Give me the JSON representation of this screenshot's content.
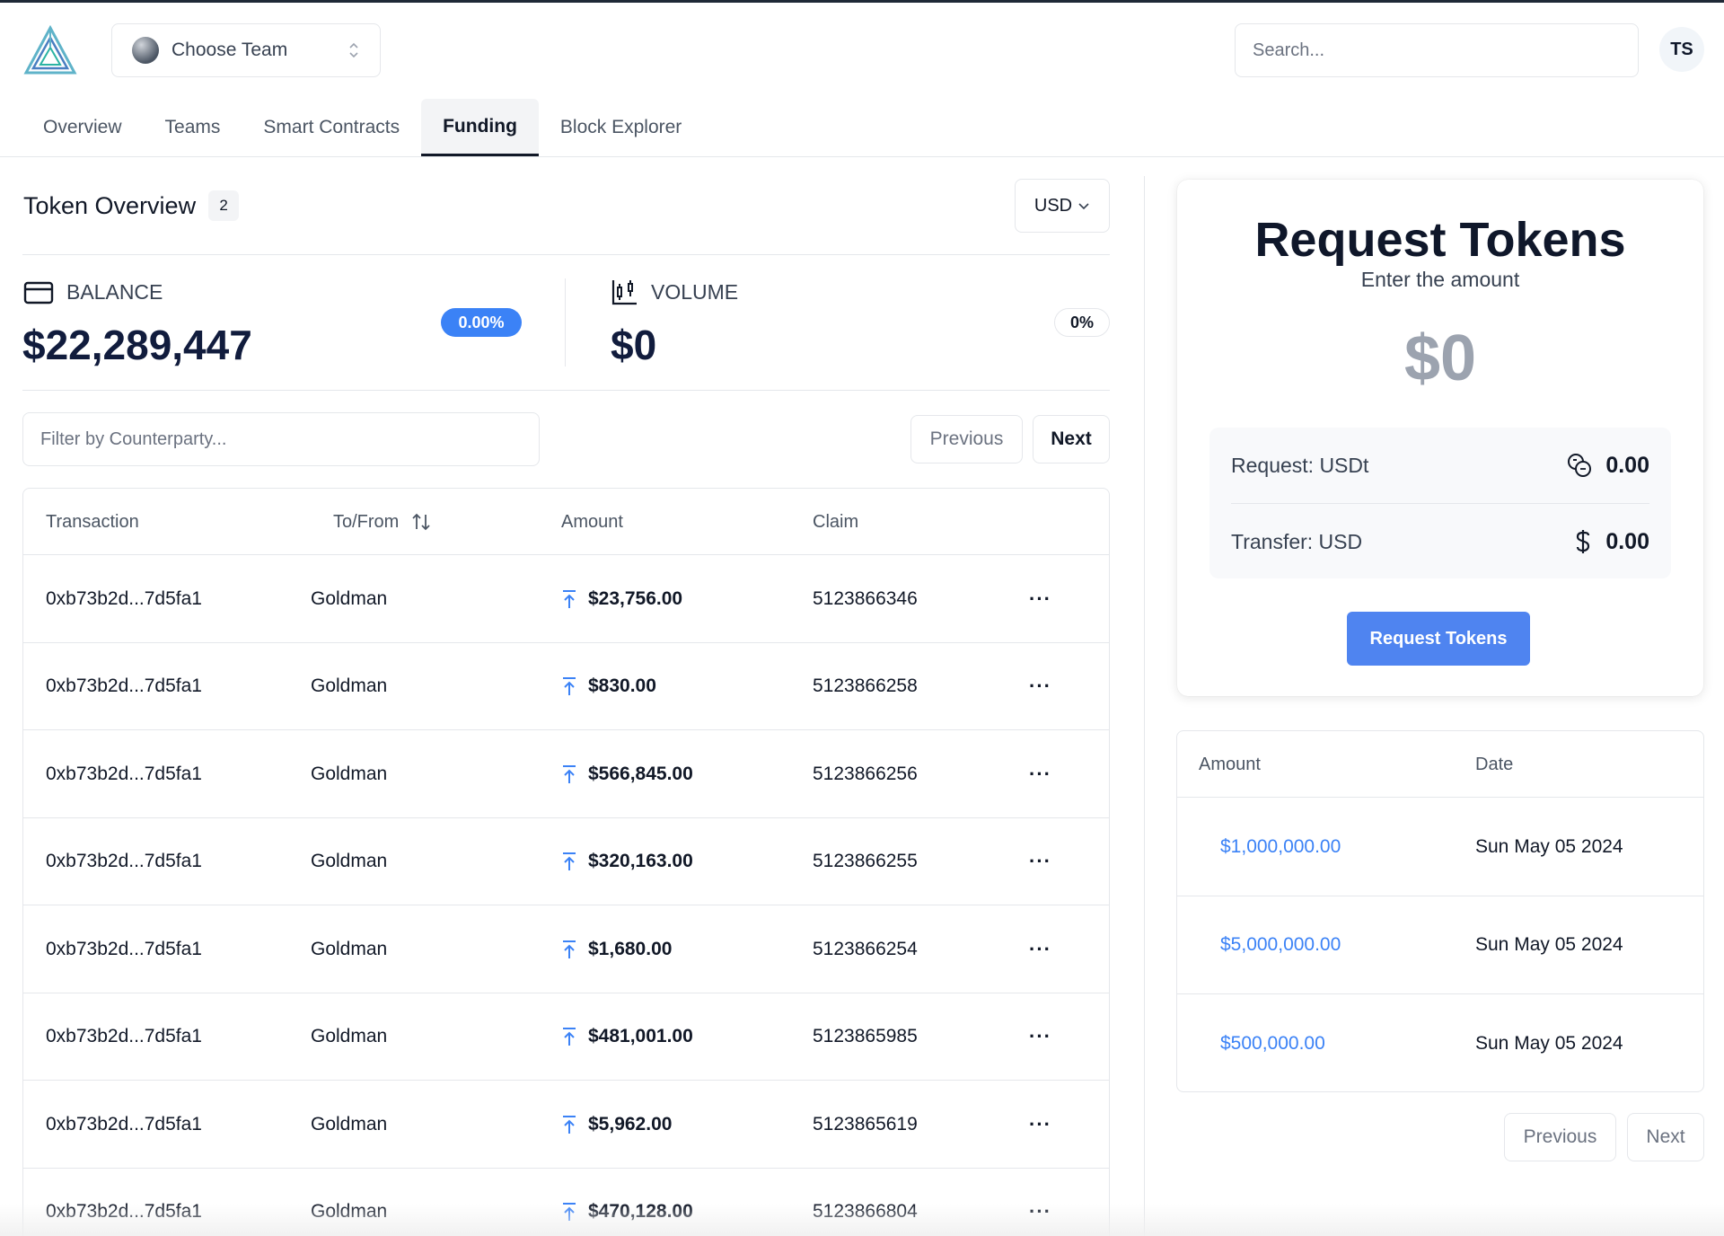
{
  "header": {
    "team_select_label": "Choose Team",
    "search_placeholder": "Search...",
    "user_initials": "TS"
  },
  "nav": {
    "tabs": [
      {
        "label": "Overview"
      },
      {
        "label": "Teams"
      },
      {
        "label": "Smart Contracts"
      },
      {
        "label": "Funding",
        "active": true
      },
      {
        "label": "Block Explorer"
      }
    ]
  },
  "token_overview": {
    "title": "Token Overview",
    "count": "2",
    "currency": "USD",
    "balance_label": "BALANCE",
    "balance_value": "$22,289,447",
    "balance_change": "0.00%",
    "volume_label": "VOLUME",
    "volume_value": "$0",
    "volume_change": "0%"
  },
  "transactions": {
    "filter_placeholder": "Filter by Counterparty...",
    "previous_label": "Previous",
    "next_label": "Next",
    "columns": {
      "transaction": "Transaction",
      "to_from": "To/From",
      "amount": "Amount",
      "claim": "Claim"
    },
    "rows": [
      {
        "transaction": "0xb73b2d...7d5fa1",
        "to_from": "Goldman",
        "amount": "$23,756.00",
        "claim": "5123866346"
      },
      {
        "transaction": "0xb73b2d...7d5fa1",
        "to_from": "Goldman",
        "amount": "$830.00",
        "claim": "5123866258"
      },
      {
        "transaction": "0xb73b2d...7d5fa1",
        "to_from": "Goldman",
        "amount": "$566,845.00",
        "claim": "5123866256"
      },
      {
        "transaction": "0xb73b2d...7d5fa1",
        "to_from": "Goldman",
        "amount": "$320,163.00",
        "claim": "5123866255"
      },
      {
        "transaction": "0xb73b2d...7d5fa1",
        "to_from": "Goldman",
        "amount": "$1,680.00",
        "claim": "5123866254"
      },
      {
        "transaction": "0xb73b2d...7d5fa1",
        "to_from": "Goldman",
        "amount": "$481,001.00",
        "claim": "5123865985"
      },
      {
        "transaction": "0xb73b2d...7d5fa1",
        "to_from": "Goldman",
        "amount": "$5,962.00",
        "claim": "5123865619"
      },
      {
        "transaction": "0xb73b2d...7d5fa1",
        "to_from": "Goldman",
        "amount": "$470,128.00",
        "claim": "5123866804"
      }
    ],
    "row_menu_label": "···"
  },
  "request_tokens": {
    "title": "Request Tokens",
    "subtitle": "Enter the amount",
    "amount": "$0",
    "request_label": "Request: USDt",
    "request_value": "0.00",
    "transfer_label": "Transfer: USD",
    "transfer_value": "0.00",
    "button_label": "Request Tokens"
  },
  "history": {
    "columns": {
      "amount": "Amount",
      "date": "Date"
    },
    "rows": [
      {
        "amount": "$1,000,000.00",
        "date": "Sun May 05 2024"
      },
      {
        "amount": "$5,000,000.00",
        "date": "Sun May 05 2024"
      },
      {
        "amount": "$500,000.00",
        "date": "Sun May 05 2024"
      }
    ],
    "previous_label": "Previous",
    "next_label": "Next"
  },
  "colors": {
    "accent": "#3b82f6",
    "button_blue": "#4f84f0",
    "value_navy": "#111c3d"
  },
  "icons": {
    "logo": "triangle-logo-icon",
    "balance": "credit-card-icon",
    "volume": "candlestick-chart-icon",
    "amount": "arrow-up-to-line-icon",
    "request": "coins-icon",
    "transfer": "dollar-sign-icon"
  }
}
